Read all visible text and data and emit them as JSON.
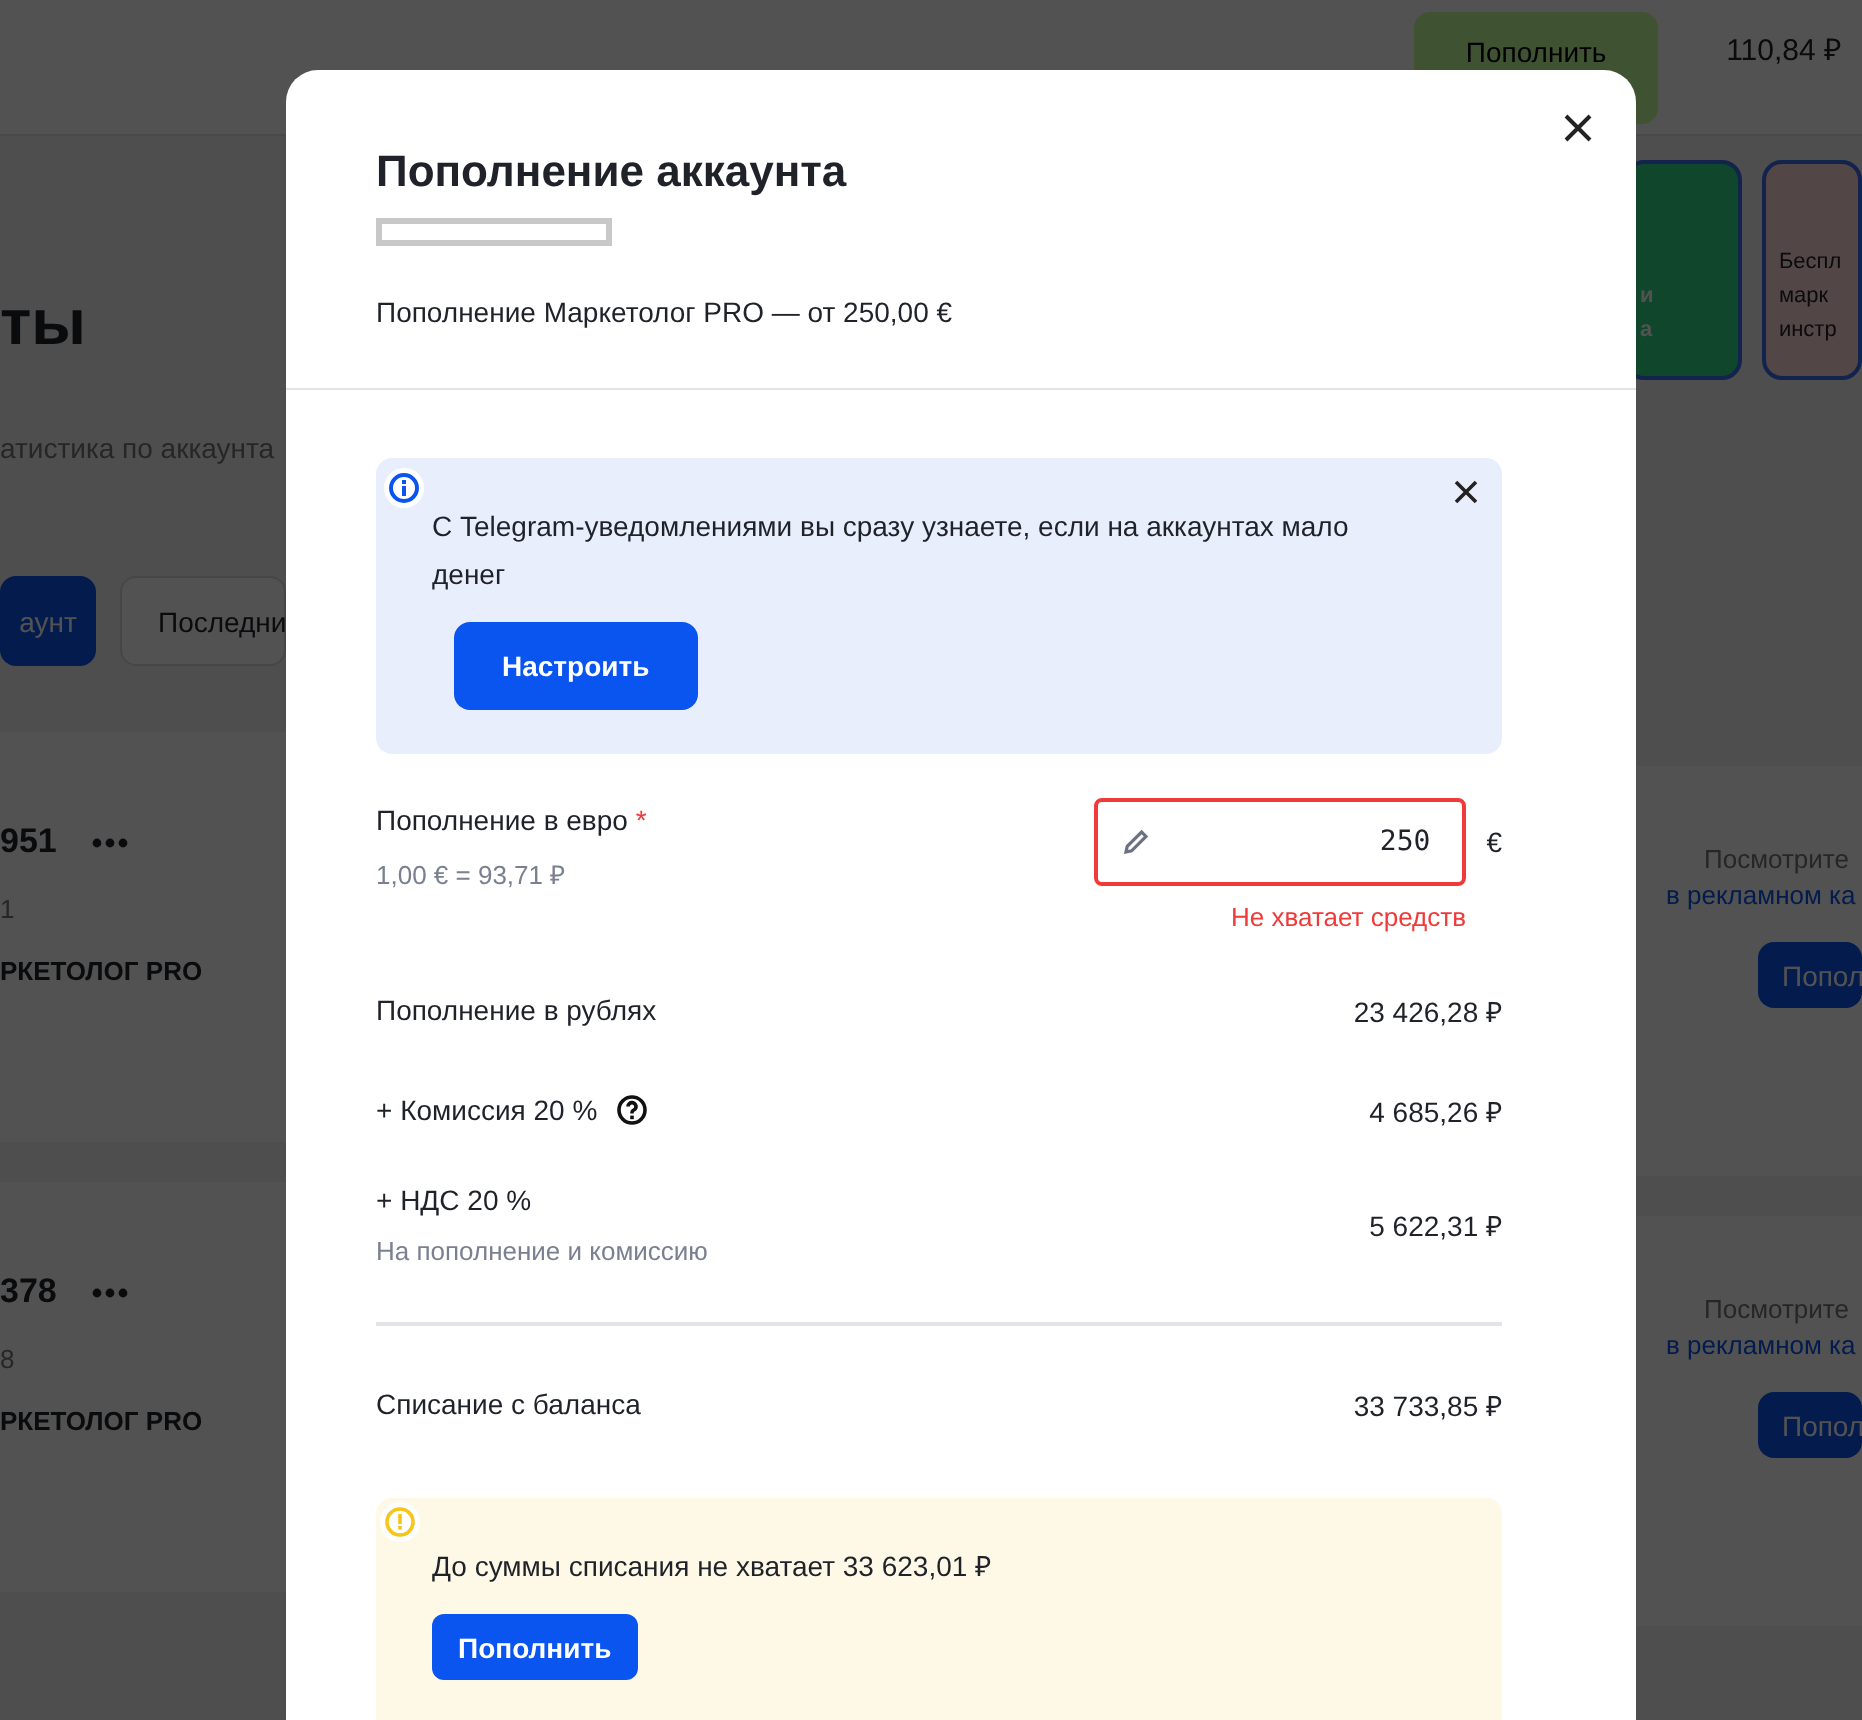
{
  "background": {
    "header": {
      "topup_button": "Пополнить",
      "balance": "110,84 ₽"
    },
    "heading": "ты",
    "subtitle": "атистика по аккаунта",
    "buttons": [
      {
        "label": "аунт",
        "kind": "primary"
      },
      {
        "label": "Последни",
        "kind": "outline"
      }
    ],
    "promo_cards": [
      {
        "lines": [
          "и",
          "а"
        ],
        "kind": "green"
      },
      {
        "lines": [
          "Беспл",
          "марк",
          "инстр"
        ],
        "kind": "pink"
      }
    ],
    "accounts": [
      {
        "number": "951",
        "sub": "1",
        "brand": "РКЕТОЛОГ PRO",
        "hint": "Посмотрите",
        "link": "в рекламном ка",
        "button": "Попол"
      },
      {
        "number": "378",
        "sub": "8",
        "brand": "РКЕТОЛОГ PRO",
        "hint": "Посмотрите",
        "link": "в рекламном ка",
        "button": "Попол"
      }
    ]
  },
  "modal": {
    "title": "Пополнение аккаунта",
    "description": "Пополнение Маркетолог PRO — от 250,00 €",
    "info_banner": {
      "text": "С Telegram-уведомлениями вы сразу узнаете, если на аккаунтах мало денег",
      "button": "Настроить"
    },
    "amount_field": {
      "label": "Пополнение в евро",
      "required_mark": "*",
      "rate": "1,00 € = 93,71 ₽",
      "value": "250",
      "currency": "€",
      "error": "Не хватает средств"
    },
    "rows": [
      {
        "label": "Пополнение в рублях",
        "value": "23 426,28 ₽",
        "help": false
      },
      {
        "label": "+ Комиссия 20 %",
        "value": "4 685,26 ₽",
        "help": true
      },
      {
        "label": "+ НДС 20 %",
        "note": "На пополнение и комиссию",
        "value": "5 622,31 ₽",
        "help": false
      }
    ],
    "total": {
      "label": "Списание с баланса",
      "value": "33 733,85 ₽"
    },
    "warning_banner": {
      "text": "До суммы списания не хватает 33 623,01 ₽",
      "button": "Пополнить"
    }
  }
}
